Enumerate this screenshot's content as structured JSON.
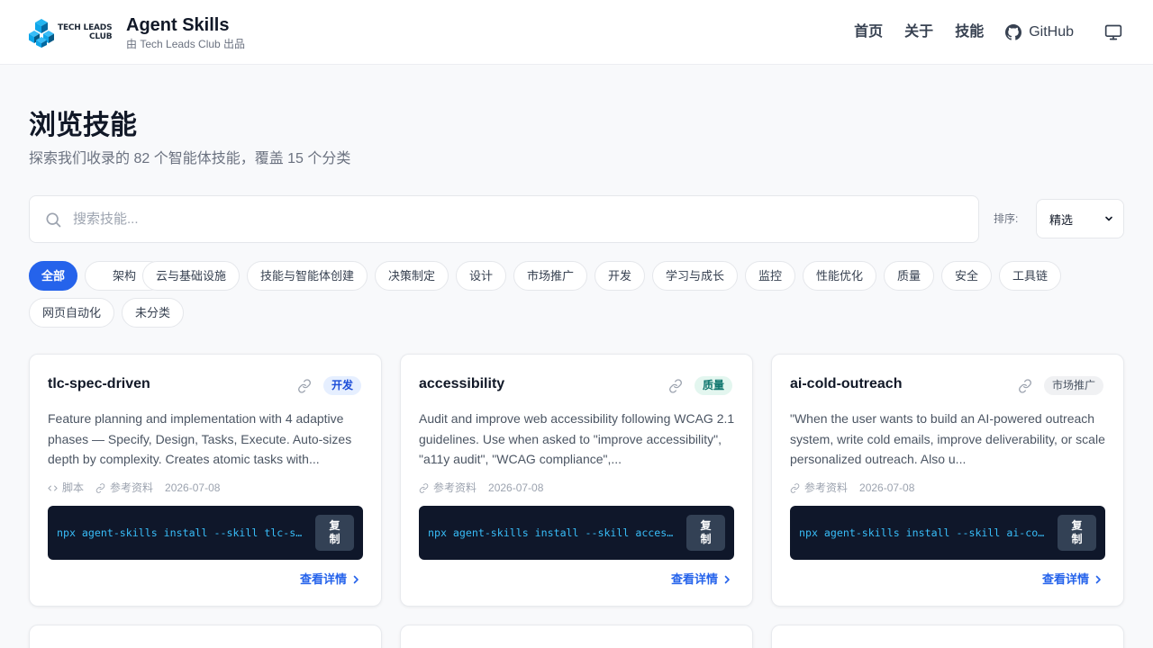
{
  "header": {
    "logo_line1": "TECH LEADS",
    "logo_line2": "CLUB",
    "title": "Agent Skills",
    "subtitle": "由 Tech Leads Club 出品",
    "nav": [
      "首页",
      "关于",
      "技能",
      "GitHub"
    ]
  },
  "hero": {
    "title": "浏览技能",
    "subtitle": "探索我们收录的 82 个智能体技能，覆盖 15 个分类"
  },
  "search": {
    "placeholder": "搜索技能..."
  },
  "sort": {
    "label": "排序:",
    "value": "精选"
  },
  "filters": [
    "全部",
    "架构",
    "云与基础设施",
    "技能与智能体创建",
    "决策制定",
    "设计",
    "市场推广",
    "开发",
    "学习与成长",
    "监控",
    "性能优化",
    "质量",
    "安全",
    "工具链",
    "网页自动化",
    "未分类"
  ],
  "active_filter": "全部",
  "cards": [
    {
      "title": "tlc-spec-driven",
      "badge": "开发",
      "badge_color": "#1d4ed8",
      "description": "Feature planning and implementation with 4 adaptive phases — Specify, Design, Tasks, Execute. Auto-sizes depth by complexity. Creates atomic tasks with...",
      "meta_scripts": "脚本",
      "meta_refs": "参考资料",
      "date": "2026-07-08",
      "command": "npx agent-skills install --skill tlc-spec-driven",
      "copy_label": "复制",
      "details_label": "查看详情"
    },
    {
      "title": "accessibility",
      "badge": "质量",
      "badge_color": "#0f766e",
      "description": "Audit and improve web accessibility following WCAG 2.1 guidelines. Use when asked to \"improve accessibility\", \"a11y audit\", \"WCAG compliance\",...",
      "meta_refs": "参考资料",
      "date": "2026-07-08",
      "command": "npx agent-skills install --skill accessibility",
      "copy_label": "复制",
      "details_label": "查看详情"
    },
    {
      "title": "ai-cold-outreach",
      "badge": "市场推广",
      "badge_color": "#4b5563",
      "description": "\"When the user wants to build an AI-powered outreach system, write cold emails, improve deliverability, or scale personalized outreach. Also u...",
      "meta_refs": "参考资料",
      "date": "2026-07-08",
      "command": "npx agent-skills install --skill ai-cold-outreach",
      "copy_label": "复制",
      "details_label": "查看详情"
    }
  ],
  "colors": {
    "accent": "#2563eb",
    "code_bg": "#0f172a",
    "code_text": "#38bdf8"
  }
}
